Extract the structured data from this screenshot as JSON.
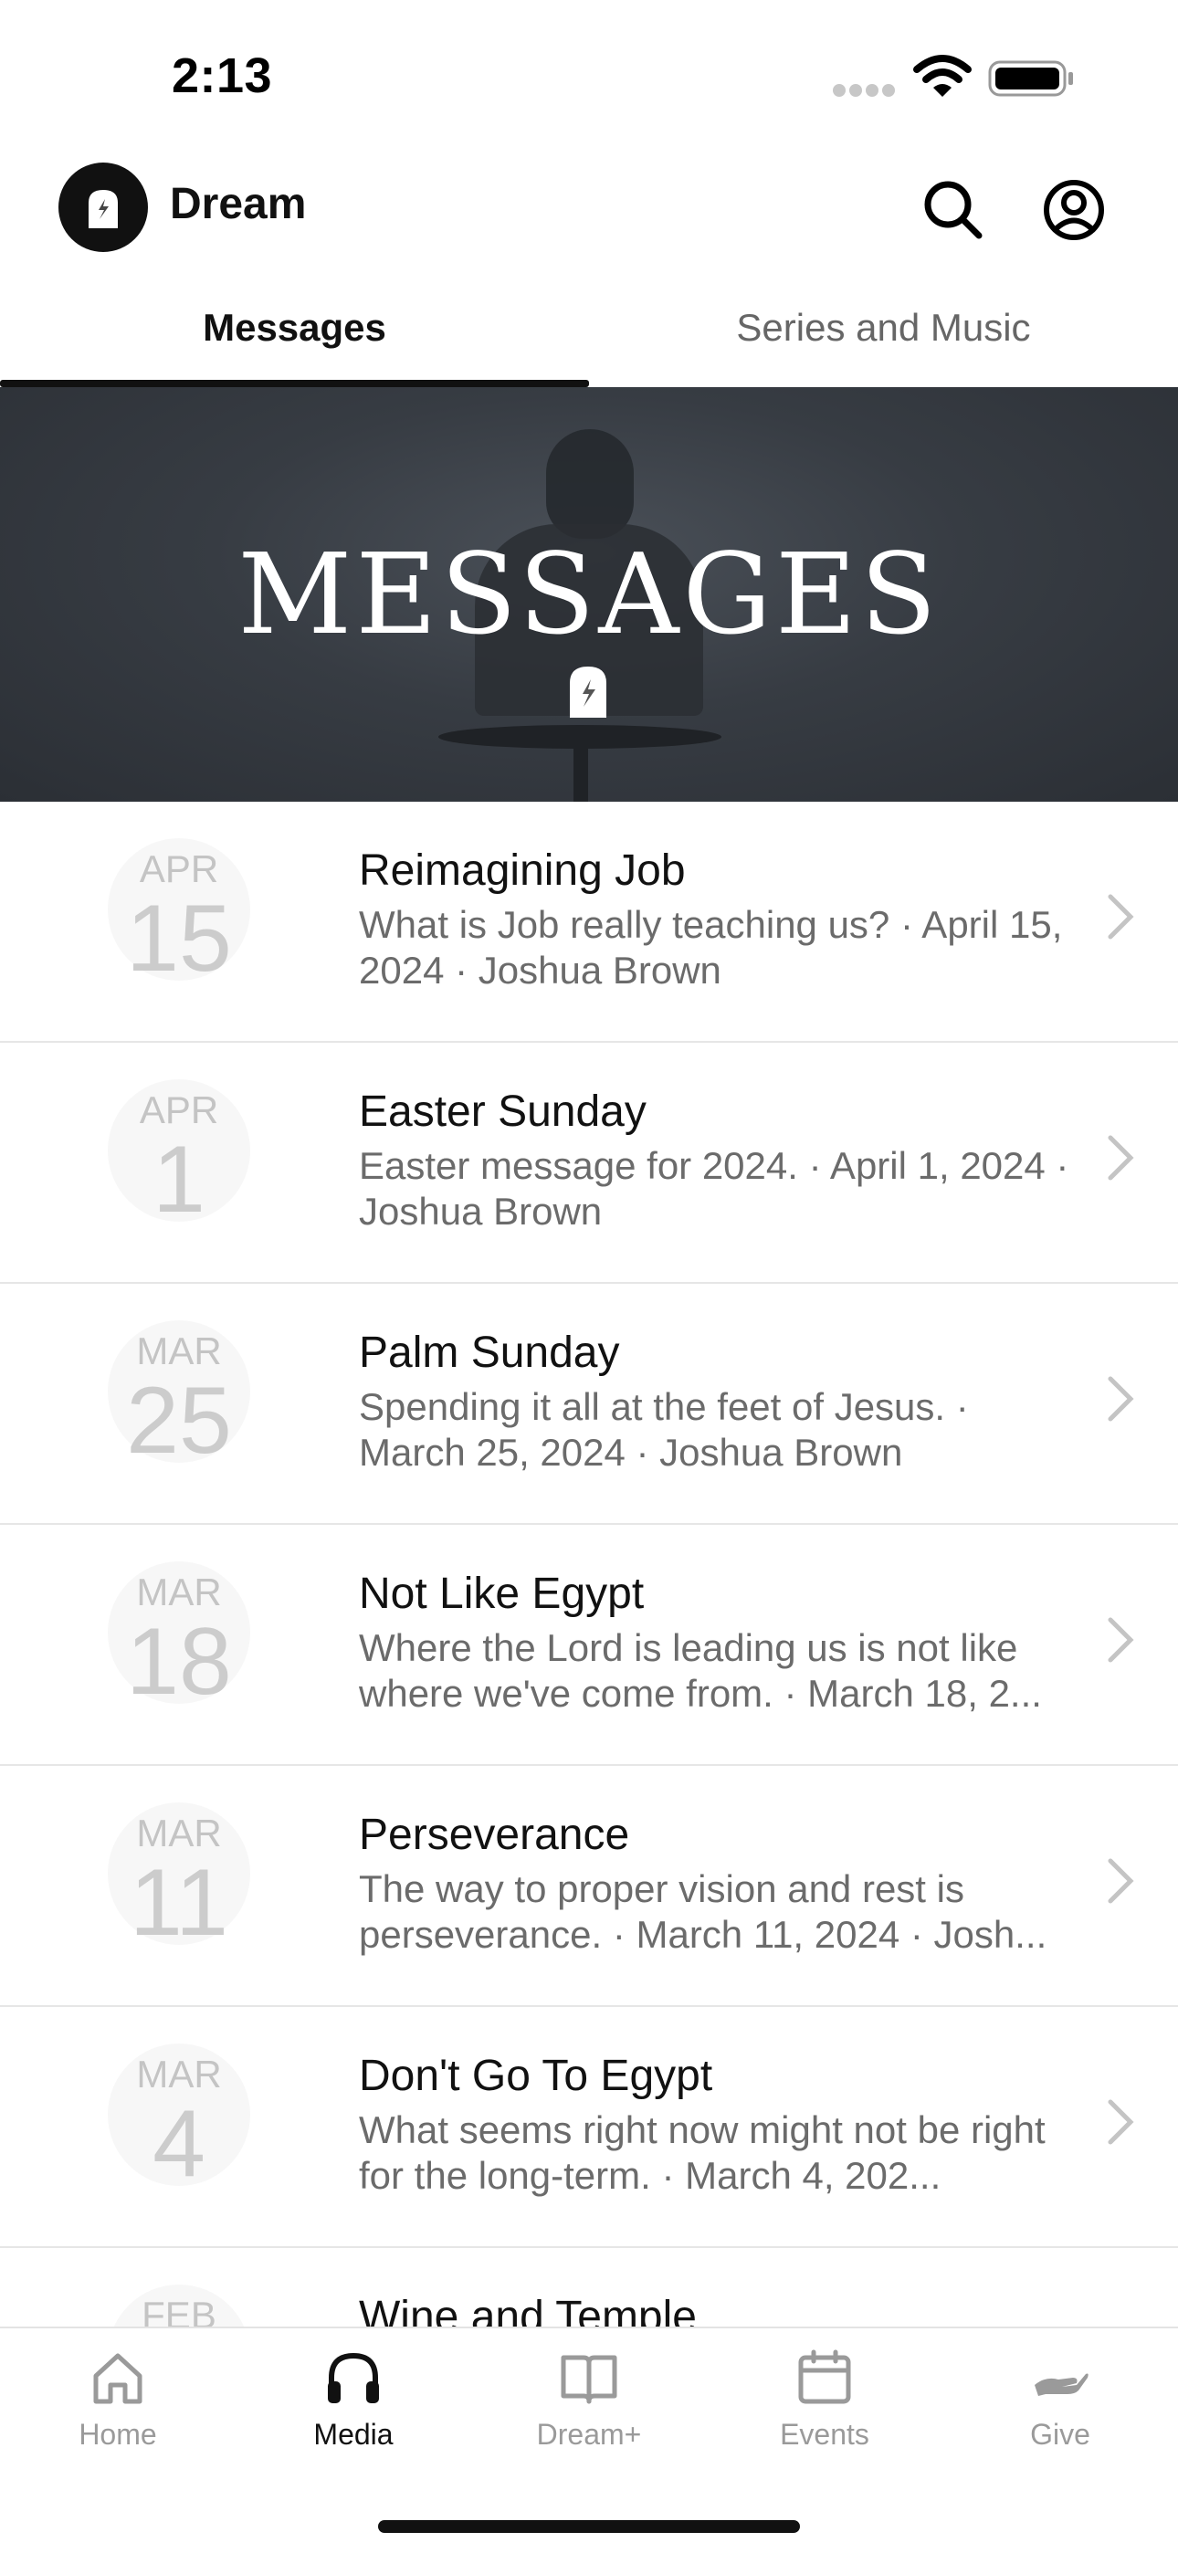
{
  "status_bar": {
    "time": "2:13"
  },
  "header": {
    "app_name": "Dream"
  },
  "tabs": [
    {
      "label": "Messages",
      "active": true
    },
    {
      "label": "Series and Music",
      "active": false
    }
  ],
  "banner": {
    "title": "MESSAGES"
  },
  "messages": [
    {
      "month": "APR",
      "day": "15",
      "title": "Reimagining Job",
      "subtitle": "What is Job really teaching us? · April 15, 2024 · Joshua Brown"
    },
    {
      "month": "APR",
      "day": "1",
      "title": "Easter Sunday",
      "subtitle": "Easter message for 2024. · April 1, 2024 · Joshua Brown"
    },
    {
      "month": "MAR",
      "day": "25",
      "title": "Palm Sunday",
      "subtitle": "Spending it all at the feet of Jesus. · March 25, 2024 · Joshua Brown"
    },
    {
      "month": "MAR",
      "day": "18",
      "title": "Not Like Egypt",
      "subtitle": "Where the Lord is leading us is not like where we've come from. · March 18, 2..."
    },
    {
      "month": "MAR",
      "day": "11",
      "title": "Perseverance",
      "subtitle": "The way to proper vision and rest is perseverance. · March 11, 2024 · Josh..."
    },
    {
      "month": "MAR",
      "day": "4",
      "title": "Don't Go To Egypt",
      "subtitle": "What seems right now might not be right for the long-term. · March 4, 202..."
    },
    {
      "month": "FEB",
      "day": "",
      "title": "Wine and Temple",
      "subtitle": ""
    }
  ],
  "tab_bar": [
    {
      "label": "Home",
      "icon": "home-icon",
      "active": false
    },
    {
      "label": "Media",
      "icon": "headphones-icon",
      "active": true
    },
    {
      "label": "Dream+",
      "icon": "book-icon",
      "active": false
    },
    {
      "label": "Events",
      "icon": "calendar-icon",
      "active": false
    },
    {
      "label": "Give",
      "icon": "hand-icon",
      "active": false
    }
  ],
  "colors": {
    "text": "#111111",
    "muted": "#6b6b6b",
    "inactive": "#9a9a9a",
    "divider": "#e6e6e6",
    "banner": "#373c43"
  }
}
